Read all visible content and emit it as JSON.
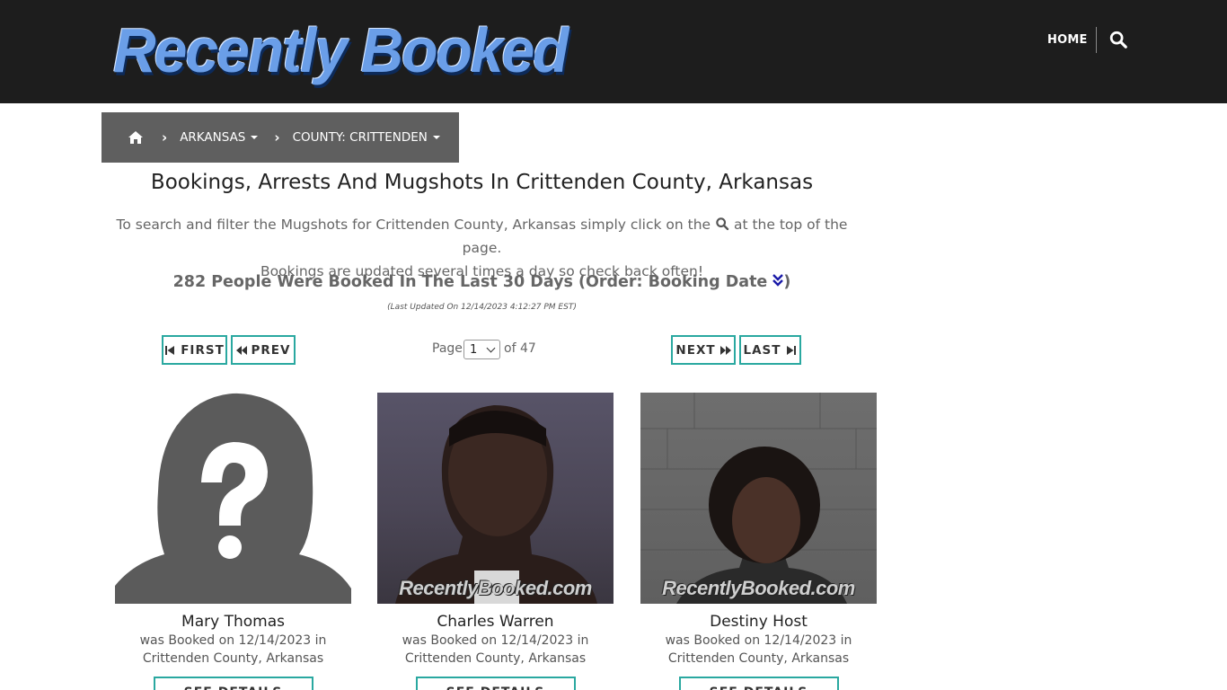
{
  "header": {
    "logo_text": "Recently Booked",
    "nav_home": "HOME"
  },
  "breadcrumb": {
    "state": "ARKANSAS",
    "county": "COUNTY: CRITTENDEN"
  },
  "main": {
    "title": "Bookings, Arrests And Mugshots In Crittenden County, Arkansas",
    "intro_part1": "To search and filter the Mugshots for Crittenden County, Arkansas simply click on the",
    "intro_part2": "at the top of the page.",
    "intro_line2": "Bookings are updated several times a day so check back often!",
    "count_text": "282 People Were Booked In The Last 30 Days (Order: Booking Date",
    "count_close": ")",
    "last_updated": "(Last Updated On 12/14/2023 4:12:27 PM EST)"
  },
  "pagination": {
    "first": "FIRST",
    "prev": "PREV",
    "next": "NEXT",
    "last": "LAST",
    "page_label": "Page",
    "current_page": "1",
    "of_label": "of 47"
  },
  "cards": [
    {
      "name": "Mary Thomas",
      "line1": "was Booked on 12/14/2023 in",
      "line2": "Crittenden County, Arkansas",
      "button": "SEE DETAILS",
      "watermark": ""
    },
    {
      "name": "Charles Warren",
      "line1": "was Booked on 12/14/2023 in",
      "line2": "Crittenden County, Arkansas",
      "button": "SEE DETAILS",
      "watermark": "RecentlyBooked.com"
    },
    {
      "name": "Destiny Host",
      "line1": "was Booked on 12/14/2023 in",
      "line2": "Crittenden County, Arkansas",
      "button": "SEE DETAILS",
      "watermark": "RecentlyBooked.com"
    }
  ],
  "colors": {
    "header_bg": "#1d1d1d",
    "breadcrumb_bg": "#5f5f5f",
    "accent_border": "#2aa8a0",
    "order_icon": "#1a1aa8"
  },
  "icons": {
    "home": "home-icon",
    "search": "search-icon",
    "order": "double-chevron-down-icon",
    "first": "step-backward-icon",
    "prev": "fast-backward-icon",
    "next": "fast-forward-icon",
    "last": "step-forward-icon"
  }
}
